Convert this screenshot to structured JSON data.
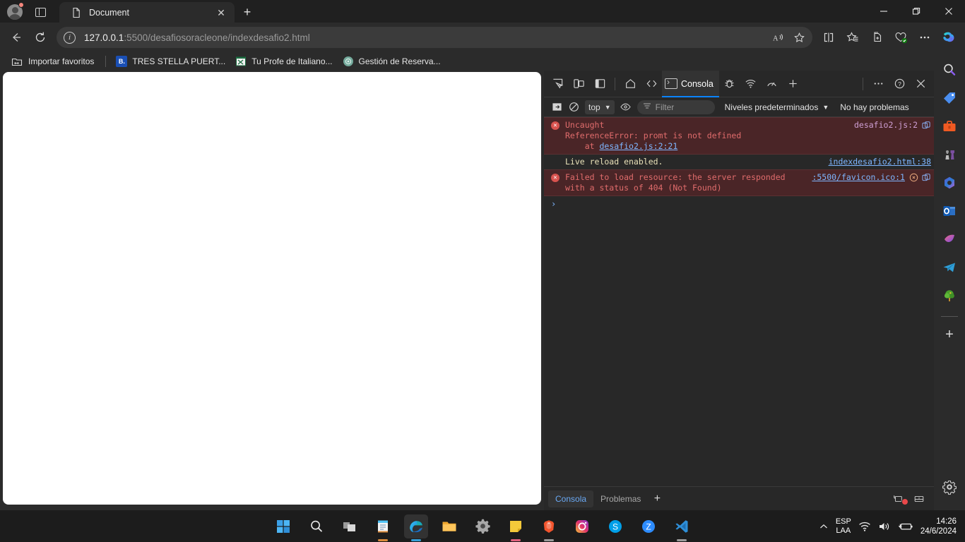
{
  "browser": {
    "tab": {
      "title": "Document",
      "favicon": "document-icon",
      "close_label": "✕"
    },
    "new_tab_label": "+",
    "window_controls": {
      "minimize": "—",
      "maximize": "❐",
      "close": "✕"
    },
    "address": {
      "host": "127.0.0.1",
      "path": ":5500/desafiosoracleone/indexdesafio2.html",
      "full": "127.0.0.1:5500/desafiosoracleone/indexdesafio2.html"
    },
    "toolbar_icons": [
      "back-icon",
      "refresh-icon",
      "read-aloud-icon",
      "favorite-star-icon",
      "split-screen-icon",
      "collections-icon",
      "add-to-collection-icon",
      "browser-essentials-icon",
      "settings-more-icon",
      "copilot-icon"
    ],
    "bookmarks": [
      {
        "label": "Importar favoritos",
        "icon": "import-favorites-icon"
      },
      {
        "label": "TRES STELLA PUERT...",
        "icon": "booking-b-icon",
        "icon_text": "B."
      },
      {
        "label": "Tu Profe de Italiano...",
        "icon": "excel-sheet-icon"
      },
      {
        "label": "Gestión de Reserva...",
        "icon": "chatgpt-icon"
      }
    ]
  },
  "devtools": {
    "toolbar_icons": [
      "inspect-element-icon",
      "device-toolbar-icon",
      "dock-side-icon",
      "home-icon",
      "elements-code-icon"
    ],
    "right_icons": [
      "debugger-bug-icon",
      "network-wifi-icon",
      "performance-icon",
      "add-panel-icon",
      "more-tools-icon",
      "help-icon",
      "close-devtools-icon"
    ],
    "active_tab": {
      "label": "Consola",
      "icon": "console-icon",
      "has_error_badge": true
    },
    "filterbar": {
      "sidebar_toggle": "console-sidebar-icon",
      "clear_console": "clear-console-icon",
      "context": "top",
      "context_caret": "▼",
      "live_expression": "eye-icon",
      "filter_placeholder": "Filter",
      "filter_icon": "filter-icon",
      "levels_label": "Niveles predeterminados",
      "levels_caret": "▼",
      "issues_label": "No hay problemas"
    },
    "messages": [
      {
        "type": "error",
        "icon": "error-icon",
        "lines": [
          "Uncaught",
          "ReferenceError: promt is not defined",
          "    at "
        ],
        "link_in_body": "desafio2.js:2:21",
        "source": "desafio2.js:2",
        "trailing_icons": [
          "open-in-sources-icon"
        ]
      },
      {
        "type": "log",
        "icon": "",
        "lines": [
          "Live reload enabled."
        ],
        "link_in_body": "",
        "source": "indexdesafio2.html:38",
        "trailing_icons": []
      },
      {
        "type": "error",
        "icon": "error-icon",
        "lines": [
          "Failed to load resource: the server responded",
          "with a status of 404 (Not Found)"
        ],
        "link_in_body": "",
        "source": ":5500/favicon.ico:1",
        "trailing_icons": [
          "issue-warning-icon",
          "open-in-sources-icon"
        ]
      }
    ],
    "prompt_symbol": "›",
    "drawer": {
      "tabs": [
        {
          "label": "Consola",
          "active": true
        },
        {
          "label": "Problemas",
          "active": false
        }
      ],
      "plus_label": "+",
      "right_icons": [
        "restore-drawer-icon",
        "dock-drawer-icon"
      ]
    }
  },
  "edge_sidebar": {
    "items": [
      {
        "name": "search-icon"
      },
      {
        "name": "shopping-tag-icon"
      },
      {
        "name": "tools-toolbox-icon"
      },
      {
        "name": "games-chess-icon"
      },
      {
        "name": "microsoft-365-icon"
      },
      {
        "name": "outlook-icon"
      },
      {
        "name": "designer-icon"
      },
      {
        "name": "telegram-icon"
      },
      {
        "name": "tree-icon"
      }
    ],
    "add_label": "+",
    "settings_icon": "gear-icon"
  },
  "taskbar": {
    "items": [
      {
        "name": "start-windows-icon",
        "active": false,
        "running": false
      },
      {
        "name": "search-icon",
        "active": false,
        "running": false
      },
      {
        "name": "task-view-icon",
        "active": false,
        "running": false
      },
      {
        "name": "notepad-icon",
        "active": false,
        "running": true,
        "indicator_color": "#d98a3a"
      },
      {
        "name": "microsoft-edge-icon",
        "active": true,
        "running": true,
        "indicator_color": "#35a0d8"
      },
      {
        "name": "file-explorer-icon",
        "active": false,
        "running": false
      },
      {
        "name": "settings-gear-icon",
        "active": false,
        "running": false
      },
      {
        "name": "sticky-notes-icon",
        "active": false,
        "running": true,
        "indicator_color": "#e2617e"
      },
      {
        "name": "brave-browser-icon",
        "active": false,
        "running": true,
        "indicator_color": "#9a9a9a"
      },
      {
        "name": "instagram-icon",
        "active": false,
        "running": false
      },
      {
        "name": "skype-icon",
        "active": false,
        "running": false
      },
      {
        "name": "zoom-icon",
        "active": false,
        "running": false
      },
      {
        "name": "vscode-icon",
        "active": false,
        "running": true,
        "indicator_color": "#9a9a9a"
      }
    ],
    "tray": {
      "overflow_icon": "chevron-up-icon",
      "language_primary": "ESP",
      "language_secondary": "LAA",
      "network_icon": "wifi-icon",
      "volume_icon": "speaker-icon",
      "battery_icon": "battery-charging-icon",
      "time": "14:26",
      "date": "24/6/2024"
    }
  }
}
